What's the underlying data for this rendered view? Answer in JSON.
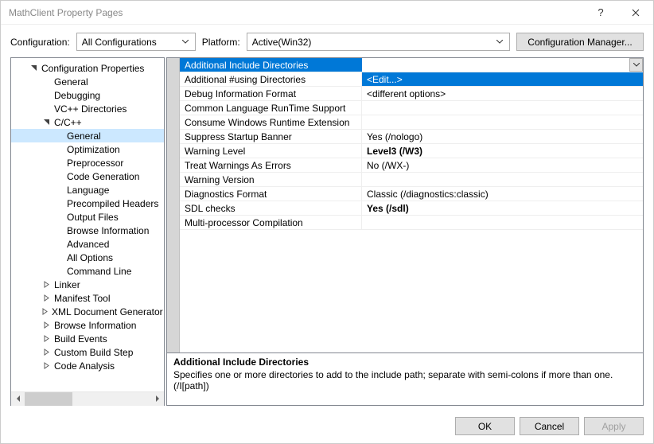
{
  "window": {
    "title": "MathClient Property Pages"
  },
  "toolbar": {
    "config_label": "Configuration:",
    "config_value": "All Configurations",
    "platform_label": "Platform:",
    "platform_value": "Active(Win32)",
    "config_mgr": "Configuration Manager..."
  },
  "tree": [
    {
      "label": "Configuration Properties",
      "level": 1,
      "exp": "open"
    },
    {
      "label": "General",
      "level": 2
    },
    {
      "label": "Debugging",
      "level": 2
    },
    {
      "label": "VC++ Directories",
      "level": 2
    },
    {
      "label": "C/C++",
      "level": 2,
      "exp": "open"
    },
    {
      "label": "General",
      "level": 3,
      "selected": true
    },
    {
      "label": "Optimization",
      "level": 3
    },
    {
      "label": "Preprocessor",
      "level": 3
    },
    {
      "label": "Code Generation",
      "level": 3
    },
    {
      "label": "Language",
      "level": 3
    },
    {
      "label": "Precompiled Headers",
      "level": 3
    },
    {
      "label": "Output Files",
      "level": 3
    },
    {
      "label": "Browse Information",
      "level": 3
    },
    {
      "label": "Advanced",
      "level": 3
    },
    {
      "label": "All Options",
      "level": 3
    },
    {
      "label": "Command Line",
      "level": 3
    },
    {
      "label": "Linker",
      "level": 2,
      "exp": "closed"
    },
    {
      "label": "Manifest Tool",
      "level": 2,
      "exp": "closed"
    },
    {
      "label": "XML Document Generator",
      "level": 2,
      "exp": "closed"
    },
    {
      "label": "Browse Information",
      "level": 2,
      "exp": "closed"
    },
    {
      "label": "Build Events",
      "level": 2,
      "exp": "closed"
    },
    {
      "label": "Custom Build Step",
      "level": 2,
      "exp": "closed"
    },
    {
      "label": "Code Analysis",
      "level": 2,
      "exp": "closed"
    }
  ],
  "props": [
    {
      "name": "Additional Include Directories",
      "value": "",
      "header": true
    },
    {
      "name": "Additional #using Directories",
      "value": "<Edit...>",
      "edit": true
    },
    {
      "name": "Debug Information Format",
      "value": "<different options>"
    },
    {
      "name": "Common Language RunTime Support",
      "value": ""
    },
    {
      "name": "Consume Windows Runtime Extension",
      "value": ""
    },
    {
      "name": "Suppress Startup Banner",
      "value": "Yes (/nologo)"
    },
    {
      "name": "Warning Level",
      "value": "Level3 (/W3)",
      "bold": true
    },
    {
      "name": "Treat Warnings As Errors",
      "value": "No (/WX-)"
    },
    {
      "name": "Warning Version",
      "value": ""
    },
    {
      "name": "Diagnostics Format",
      "value": "Classic (/diagnostics:classic)"
    },
    {
      "name": "SDL checks",
      "value": "Yes (/sdl)",
      "bold": true
    },
    {
      "name": "Multi-processor Compilation",
      "value": ""
    }
  ],
  "desc": {
    "title": "Additional Include Directories",
    "body": "Specifies one or more directories to add to the include path; separate with semi-colons if more than one. (/I[path])"
  },
  "footer": {
    "ok": "OK",
    "cancel": "Cancel",
    "apply": "Apply"
  }
}
